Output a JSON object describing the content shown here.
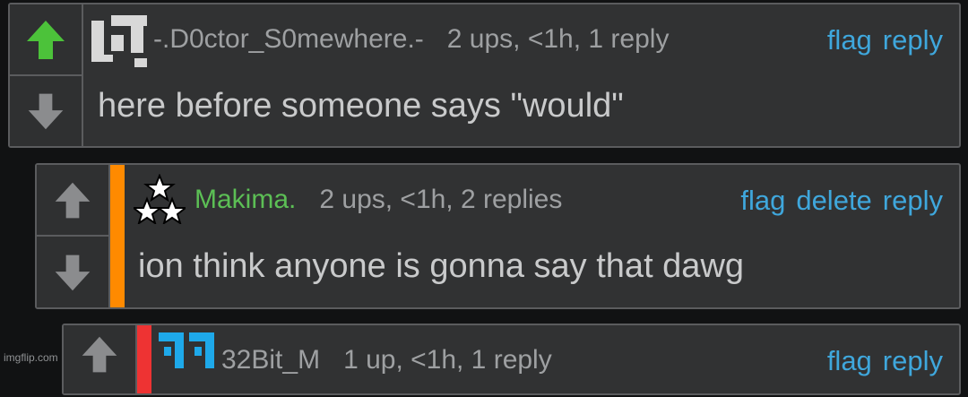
{
  "comments": [
    {
      "username": "-.D0ctor_S0mewhere.-",
      "meta": "2 ups, <1h, 1 reply",
      "actions": [
        "flag",
        "reply"
      ],
      "text": "here before someone says \"would\"",
      "upvoted": true
    },
    {
      "username": "Makima.",
      "meta": "2 ups, <1h, 2 replies",
      "actions": [
        "flag",
        "delete",
        "reply"
      ],
      "text": "ion think anyone is gonna say that dawg",
      "stripe_color": "#ff8a00",
      "username_color": "#5cbf55"
    },
    {
      "username": "32Bit_M",
      "meta": "1 up, <1h, 1 reply",
      "actions": [
        "flag",
        "reply"
      ],
      "stripe_color": "#ee3333"
    }
  ],
  "watermark": "imgflip.com",
  "colors": {
    "upvote_active": "#4cc23a",
    "arrow_inactive": "#8b8c8e",
    "link": "#3fa7dc",
    "stripe_orange": "#ff8a00",
    "stripe_red": "#ee3333",
    "avatar_cyan": "#1ea9ea"
  }
}
